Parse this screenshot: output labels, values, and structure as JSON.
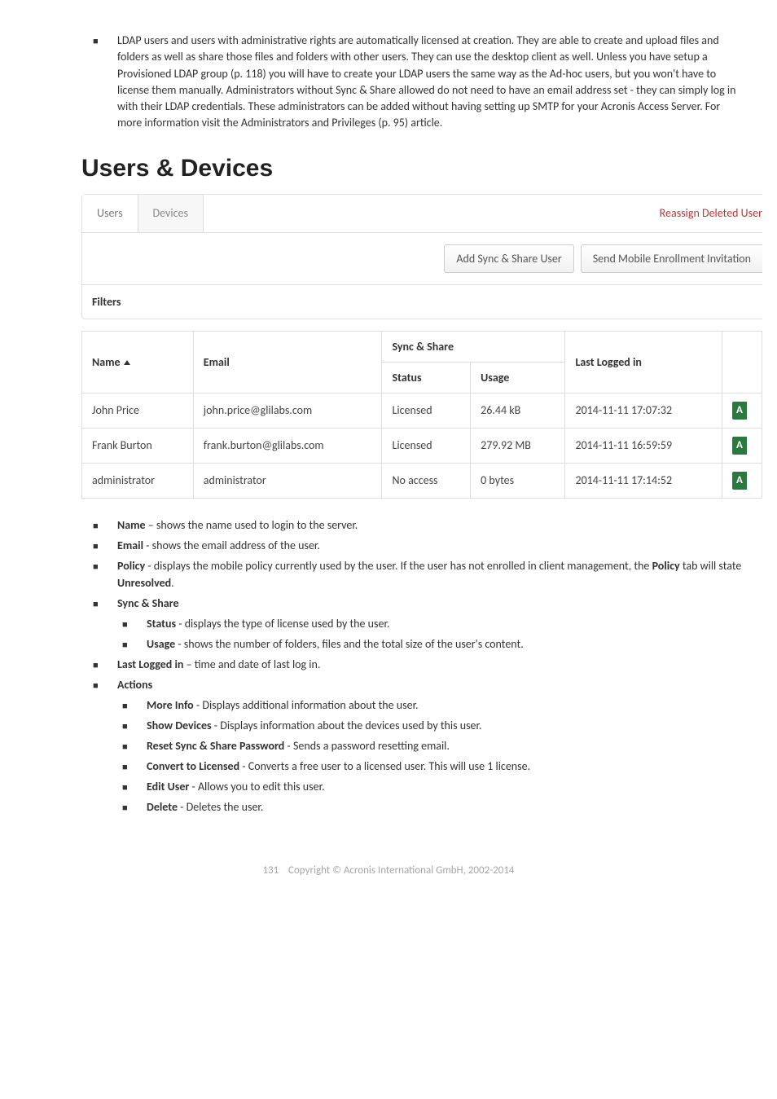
{
  "intro_paragraph": "LDAP users and users with administrative rights are automatically licensed at creation. They are able to create and upload files and folders as well as share those files and folders with other users. They can use the desktop client as well. Unless you have setup a Provisioned LDAP group (p. 118) you will have to create your LDAP users the same way as the Ad-hoc users, but you won't have to license them manually. Administrators without Sync & Share allowed do not need to have an email address set - they can simply log in with their LDAP credentials. These administrators can be added without having setting up SMTP for your Acronis Access Server. For more information visit the Administrators and Privileges (p. 95) article.",
  "section_title": "Users & Devices",
  "tabs": {
    "users": "Users",
    "devices": "Devices"
  },
  "reassign_link": "Reassign Deleted User",
  "buttons": {
    "add_user": "Add Sync & Share User",
    "send_invitation": "Send Mobile Enrollment Invitation"
  },
  "filters_label": "Filters",
  "table": {
    "group_header": "Sync & Share",
    "columns": {
      "name": "Name",
      "email": "Email",
      "status": "Status",
      "usage": "Usage",
      "last_logged": "Last Logged in"
    },
    "rows": [
      {
        "name": "John Price",
        "email": "john.price@glilabs.com",
        "status": "Licensed",
        "usage": "26.44 kB",
        "last_logged": "2014-11-11 17:07:32",
        "badge": "A"
      },
      {
        "name": "Frank Burton",
        "email": "frank.burton@glilabs.com",
        "status": "Licensed",
        "usage": "279.92 MB",
        "last_logged": "2014-11-11 16:59:59",
        "badge": "A"
      },
      {
        "name": "administrator",
        "email": "administrator",
        "status": "No access",
        "usage": "0 bytes",
        "last_logged": "2014-11-11 17:14:52",
        "badge": "A"
      }
    ]
  },
  "definitions": {
    "name": {
      "term": "Name",
      "desc": " – shows the name used to login to the server."
    },
    "email": {
      "term": "Email",
      "desc": " - shows the email address of the user."
    },
    "policy": {
      "term": "Policy",
      "desc_a": " - displays the mobile policy currently used by the user. If the user has not enrolled in client management, the ",
      "desc_b": "Policy",
      "desc_c": " tab will state ",
      "desc_d": "Unresolved",
      "desc_e": "."
    },
    "sync_share": {
      "term": "Sync & Share"
    },
    "status": {
      "term": "Status",
      "desc": " - displays the type of license used by the user."
    },
    "usage": {
      "term": "Usage",
      "desc": " - shows the number of folders, files and the total size of the user's content."
    },
    "last_logged": {
      "term": "Last Logged in",
      "desc": " – time and date of last log in."
    },
    "actions": {
      "term": "Actions"
    },
    "more_info": {
      "term": "More Info",
      "desc": " - Displays additional information about the user."
    },
    "show_devices": {
      "term": "Show Devices",
      "desc": " - Displays information about the devices used by this user."
    },
    "reset_pw": {
      "term": "Reset Sync & Share Password",
      "desc": " - Sends a password resetting email."
    },
    "convert": {
      "term": "Convert to Licensed",
      "desc": " - Converts a free user to a licensed user. This will use 1 license."
    },
    "edit_user": {
      "term": "Edit User",
      "desc": " - Allows you to edit this user."
    },
    "delete": {
      "term": "Delete",
      "desc": " - Deletes the user."
    }
  },
  "footer": {
    "page": "131",
    "copyright": "Copyright © Acronis International GmbH, 2002-2014"
  }
}
